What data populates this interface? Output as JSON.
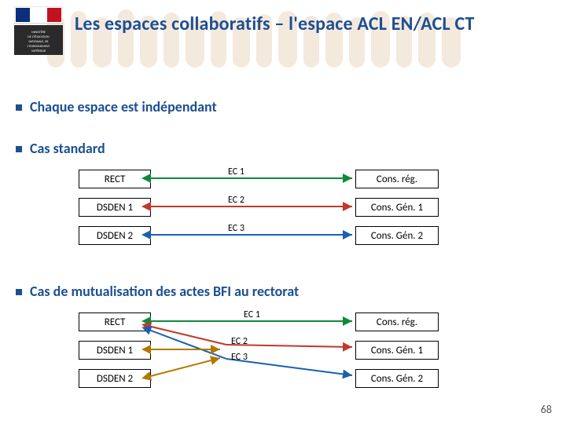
{
  "title": "Les espaces collaboratifs – l'espace ACL EN/ACL CT",
  "bullets": {
    "b1": "Chaque espace est indépendant",
    "b2": "Cas standard",
    "b3": "Cas de mutualisation des actes BFI au rectorat"
  },
  "boxes": {
    "rect": "RECT",
    "dsden1": "DSDEN 1",
    "dsden2": "DSDEN 2",
    "ec1": "EC 1",
    "ec2": "EC 2",
    "ec3": "EC 3",
    "cons_reg": "Cons. rég.",
    "cons_gen1": "Cons. Gén. 1",
    "cons_gen2": "Cons. Gén. 2"
  },
  "page_number": "68",
  "colors": {
    "title_blue": "#1d4f91",
    "arrow_green": "#0f8a3c",
    "arrow_red": "#c0392b",
    "arrow_blue": "#1b5fb0",
    "arrow_brown": "#b07a00"
  }
}
